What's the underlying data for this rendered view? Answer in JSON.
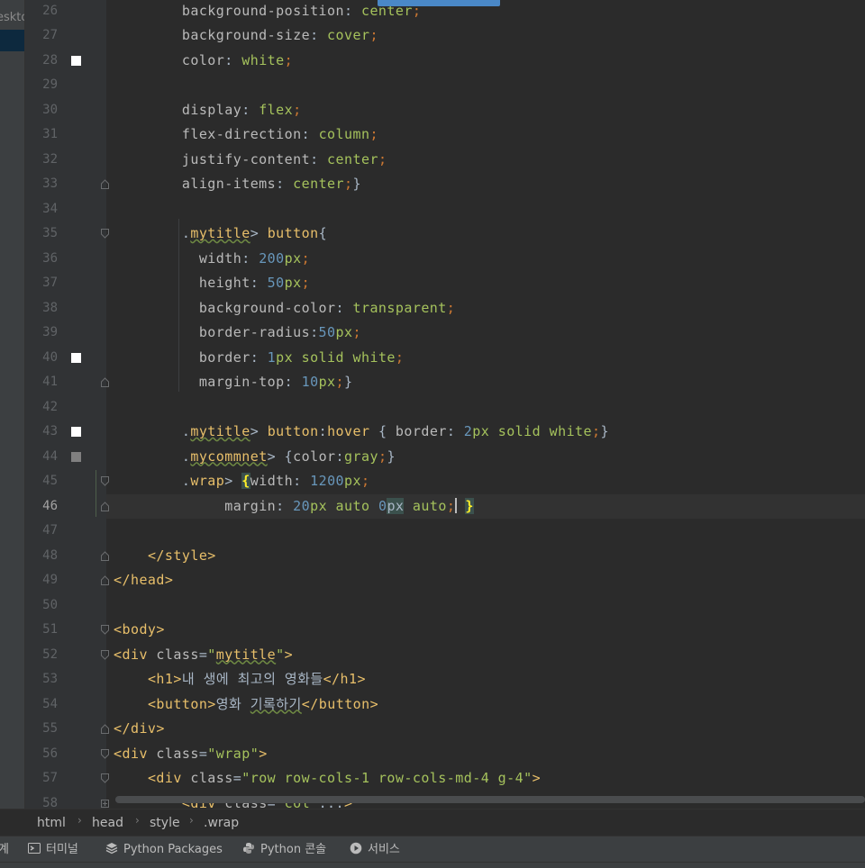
{
  "left_panel": {
    "cropped_label": "eskto"
  },
  "editor": {
    "lines": [
      {
        "n": "26",
        "marker": null,
        "fold": null,
        "tokens": [
          [
            "i8",
            ""
          ],
          [
            "pr",
            "background-position"
          ],
          [
            "d",
            ": "
          ],
          [
            "kw",
            "center"
          ],
          [
            "sc",
            ";"
          ]
        ]
      },
      {
        "n": "27",
        "marker": null,
        "fold": null,
        "tokens": [
          [
            "i8",
            ""
          ],
          [
            "pr",
            "background-size"
          ],
          [
            "d",
            ": "
          ],
          [
            "kw",
            "cover"
          ],
          [
            "sc",
            ";"
          ]
        ]
      },
      {
        "n": "28",
        "marker": "#ffffff",
        "fold": null,
        "tokens": [
          [
            "i8",
            ""
          ],
          [
            "pr",
            "color"
          ],
          [
            "d",
            ": "
          ],
          [
            "kw",
            "white"
          ],
          [
            "sc",
            ";"
          ]
        ]
      },
      {
        "n": "29",
        "marker": null,
        "fold": null,
        "tokens": []
      },
      {
        "n": "30",
        "marker": null,
        "fold": null,
        "tokens": [
          [
            "i8",
            ""
          ],
          [
            "pr",
            "display"
          ],
          [
            "d",
            ": "
          ],
          [
            "kw",
            "flex"
          ],
          [
            "sc",
            ";"
          ]
        ]
      },
      {
        "n": "31",
        "marker": null,
        "fold": null,
        "tokens": [
          [
            "i8",
            ""
          ],
          [
            "pr",
            "flex-direction"
          ],
          [
            "d",
            ": "
          ],
          [
            "kw",
            "column"
          ],
          [
            "sc",
            ";"
          ]
        ]
      },
      {
        "n": "32",
        "marker": null,
        "fold": null,
        "tokens": [
          [
            "i8",
            ""
          ],
          [
            "pr",
            "justify-content"
          ],
          [
            "d",
            ": "
          ],
          [
            "kw",
            "center"
          ],
          [
            "sc",
            ";"
          ]
        ]
      },
      {
        "n": "33",
        "marker": null,
        "fold": "end",
        "tokens": [
          [
            "i8",
            ""
          ],
          [
            "pr",
            "align-items"
          ],
          [
            "d",
            ": "
          ],
          [
            "kw",
            "center"
          ],
          [
            "sc",
            ";"
          ],
          [
            "d",
            "}"
          ]
        ]
      },
      {
        "n": "34",
        "marker": null,
        "fold": null,
        "tokens": []
      },
      {
        "n": "35",
        "marker": null,
        "fold": "start",
        "tokens": [
          [
            "i8",
            ""
          ],
          [
            "d",
            "."
          ],
          [
            "cls",
            "mytitle"
          ],
          [
            "d",
            "> "
          ],
          [
            "tg",
            "button"
          ],
          [
            "d",
            "{"
          ]
        ]
      },
      {
        "n": "36",
        "marker": null,
        "fold": null,
        "tokens": [
          [
            "i10",
            ""
          ],
          [
            "pr",
            "width"
          ],
          [
            "d",
            ": "
          ],
          [
            "nm",
            "200"
          ],
          [
            "kw",
            "px"
          ],
          [
            "sc",
            ";"
          ]
        ]
      },
      {
        "n": "37",
        "marker": null,
        "fold": null,
        "tokens": [
          [
            "i10",
            ""
          ],
          [
            "pr",
            "height"
          ],
          [
            "d",
            ": "
          ],
          [
            "nm",
            "50"
          ],
          [
            "kw",
            "px"
          ],
          [
            "sc",
            ";"
          ]
        ]
      },
      {
        "n": "38",
        "marker": null,
        "fold": null,
        "tokens": [
          [
            "i10",
            ""
          ],
          [
            "pr",
            "background-color"
          ],
          [
            "d",
            ": "
          ],
          [
            "kw",
            "transparent"
          ],
          [
            "sc",
            ";"
          ]
        ]
      },
      {
        "n": "39",
        "marker": null,
        "fold": null,
        "tokens": [
          [
            "i10",
            ""
          ],
          [
            "pr",
            "border-radius"
          ],
          [
            "d",
            ":"
          ],
          [
            "nm",
            "50"
          ],
          [
            "kw",
            "px"
          ],
          [
            "sc",
            ";"
          ]
        ]
      },
      {
        "n": "40",
        "marker": "#ffffff",
        "fold": null,
        "tokens": [
          [
            "i10",
            ""
          ],
          [
            "pr",
            "border"
          ],
          [
            "d",
            ": "
          ],
          [
            "nm",
            "1"
          ],
          [
            "kw",
            "px"
          ],
          [
            "d",
            " "
          ],
          [
            "kw",
            "solid"
          ],
          [
            "d",
            " "
          ],
          [
            "kw",
            "white"
          ],
          [
            "sc",
            ";"
          ]
        ]
      },
      {
        "n": "41",
        "marker": null,
        "fold": "end",
        "tokens": [
          [
            "i10",
            ""
          ],
          [
            "pr",
            "margin-top"
          ],
          [
            "d",
            ": "
          ],
          [
            "nm",
            "10"
          ],
          [
            "kw",
            "px"
          ],
          [
            "sc",
            ";"
          ],
          [
            "d",
            "}"
          ]
        ]
      },
      {
        "n": "42",
        "marker": null,
        "fold": null,
        "tokens": []
      },
      {
        "n": "43",
        "marker": "#ffffff",
        "fold": null,
        "tokens": [
          [
            "i8",
            ""
          ],
          [
            "d",
            "."
          ],
          [
            "cls",
            "mytitle"
          ],
          [
            "d",
            "> "
          ],
          [
            "tg",
            "button"
          ],
          [
            "d",
            ":"
          ],
          [
            "tg",
            "hover"
          ],
          [
            "d",
            " { "
          ],
          [
            "pr",
            "border"
          ],
          [
            "d",
            ": "
          ],
          [
            "nm",
            "2"
          ],
          [
            "kw",
            "px"
          ],
          [
            "d",
            " "
          ],
          [
            "kw",
            "solid"
          ],
          [
            "d",
            " "
          ],
          [
            "kw",
            "white"
          ],
          [
            "sc",
            ";"
          ],
          [
            "d",
            "}"
          ]
        ]
      },
      {
        "n": "44",
        "marker": "#808080",
        "fold": null,
        "tokens": [
          [
            "i8",
            ""
          ],
          [
            "d",
            "."
          ],
          [
            "cls",
            "mycommnet"
          ],
          [
            "d",
            "> {"
          ],
          [
            "pr",
            "color"
          ],
          [
            "d",
            ":"
          ],
          [
            "kw",
            "gray"
          ],
          [
            "sc",
            ";"
          ],
          [
            "d",
            "}"
          ]
        ]
      },
      {
        "n": "45",
        "marker": null,
        "fold": "start",
        "tokens": [
          [
            "i8",
            ""
          ],
          [
            "d",
            "."
          ],
          [
            "tg",
            "wrap"
          ],
          [
            "d",
            "> "
          ],
          [
            "hl",
            "{"
          ],
          [
            "pr",
            "width"
          ],
          [
            "d",
            ": "
          ],
          [
            "nm",
            "1200"
          ],
          [
            "kw",
            "px"
          ],
          [
            "sc",
            ";"
          ]
        ]
      },
      {
        "n": "46",
        "marker": null,
        "fold": "end",
        "current": true,
        "tokens": [
          [
            "i12",
            ""
          ],
          [
            "d",
            " "
          ],
          [
            "pr",
            "margin"
          ],
          [
            "d",
            ": "
          ],
          [
            "nm",
            "20"
          ],
          [
            "kw",
            "px"
          ],
          [
            "d",
            " "
          ],
          [
            "kw",
            "auto"
          ],
          [
            "d",
            " "
          ],
          [
            "nm",
            "0"
          ],
          [
            "hb",
            "px"
          ],
          [
            "d",
            " "
          ],
          [
            "kw",
            "auto"
          ],
          [
            "sc",
            ";"
          ],
          [
            "caret",
            ""
          ],
          [
            "d",
            " "
          ],
          [
            "hl",
            "}"
          ]
        ]
      },
      {
        "n": "47",
        "marker": null,
        "fold": null,
        "tokens": []
      },
      {
        "n": "48",
        "marker": null,
        "fold": "end",
        "tokens": [
          [
            "i4",
            ""
          ],
          [
            "tg",
            "</style>"
          ]
        ]
      },
      {
        "n": "49",
        "marker": null,
        "fold": "end",
        "tokens": [
          [
            "tg",
            "</head>"
          ]
        ]
      },
      {
        "n": "50",
        "marker": null,
        "fold": null,
        "tokens": []
      },
      {
        "n": "51",
        "marker": null,
        "fold": "start",
        "tokens": [
          [
            "tg",
            "<body>"
          ]
        ]
      },
      {
        "n": "52",
        "marker": null,
        "fold": "start",
        "tokens": [
          [
            "tg",
            "<div "
          ],
          [
            "at",
            "class"
          ],
          [
            "d",
            "="
          ],
          [
            "str",
            "\""
          ],
          [
            "cls",
            "mytitle"
          ],
          [
            "str",
            "\""
          ],
          [
            "tg",
            ">"
          ]
        ]
      },
      {
        "n": "53",
        "marker": null,
        "fold": null,
        "tokens": [
          [
            "i4",
            ""
          ],
          [
            "tg",
            "<h1>"
          ],
          [
            "d",
            "내 생에 최고의 영화들"
          ],
          [
            "tg",
            "</h1>"
          ]
        ]
      },
      {
        "n": "54",
        "marker": null,
        "fold": null,
        "tokens": [
          [
            "i4",
            ""
          ],
          [
            "tg",
            "<button>"
          ],
          [
            "d",
            "영화 "
          ],
          [
            "kr",
            "기록하기"
          ],
          [
            "tg",
            "</button>"
          ]
        ]
      },
      {
        "n": "55",
        "marker": null,
        "fold": "end",
        "tokens": [
          [
            "tg",
            "</div>"
          ]
        ]
      },
      {
        "n": "56",
        "marker": null,
        "fold": "start",
        "tokens": [
          [
            "tg",
            "<div "
          ],
          [
            "at",
            "class"
          ],
          [
            "d",
            "="
          ],
          [
            "str",
            "\"wrap\""
          ],
          [
            "tg",
            ">"
          ]
        ]
      },
      {
        "n": "57",
        "marker": null,
        "fold": "start",
        "tokens": [
          [
            "i4",
            ""
          ],
          [
            "tg",
            "<div "
          ],
          [
            "at",
            "class"
          ],
          [
            "d",
            "="
          ],
          [
            "str",
            "\"row row-cols-1 row-cols-md-4 g-4\""
          ],
          [
            "tg",
            ">"
          ]
        ]
      },
      {
        "n": "58",
        "marker": null,
        "fold": "plus",
        "tokens": [
          [
            "i8",
            ""
          ],
          [
            "tg",
            "<div "
          ],
          [
            "at",
            "class"
          ],
          [
            "d",
            "="
          ],
          [
            "str",
            "\"col\""
          ],
          [
            "d",
            "..."
          ],
          [
            "tg",
            ">"
          ]
        ]
      }
    ]
  },
  "breadcrumb": {
    "items": [
      "html",
      "head",
      "style",
      ".wrap"
    ]
  },
  "tool_windows": {
    "cropped": "계",
    "terminal": "터미널",
    "python_packages": "Python Packages",
    "python_console": "Python 콘솔",
    "services": "서비스"
  }
}
